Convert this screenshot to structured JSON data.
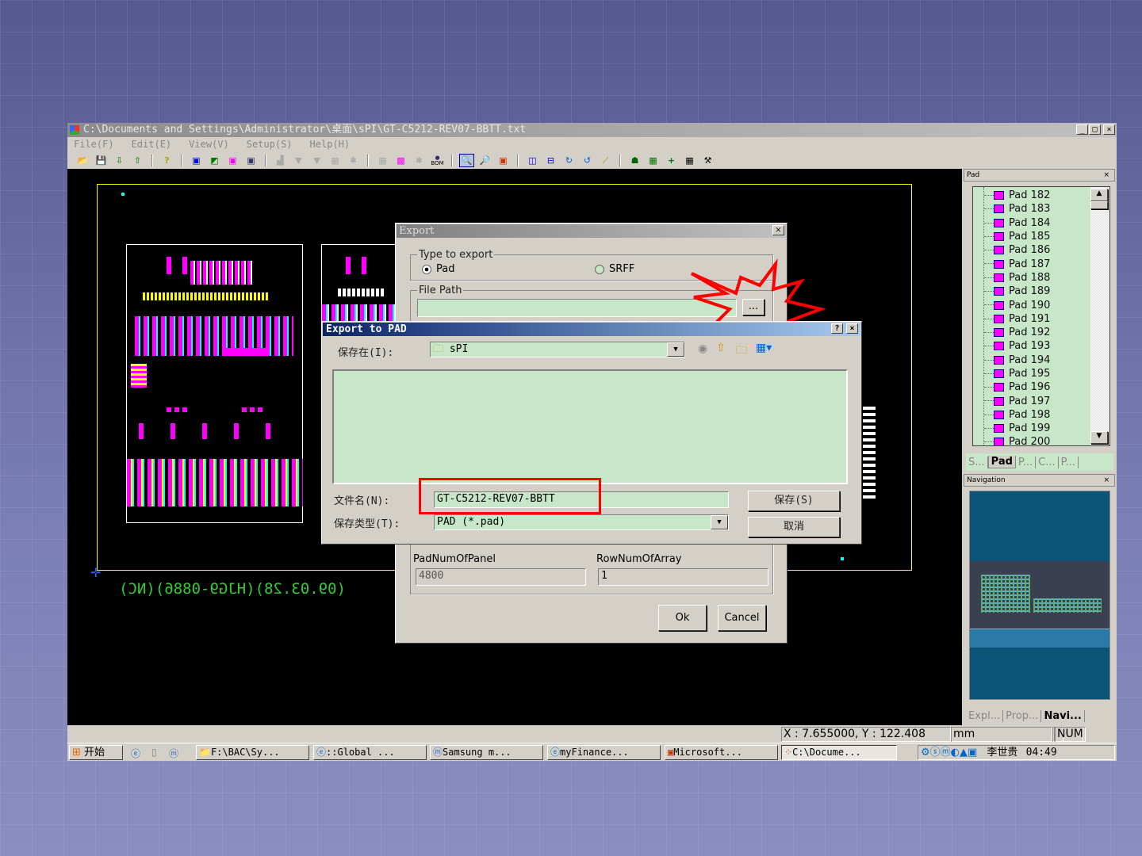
{
  "window": {
    "title": "C:\\Documents and Settings\\Administrator\\桌面\\sPI\\GT-C5212-REV07-BBTT.txt",
    "min": "_",
    "max": "□",
    "close": "×"
  },
  "menu": [
    "File(F)",
    "Edit(E)",
    "View(V)",
    "Setup(S)",
    "Help(H)"
  ],
  "toolbar": {
    "bom_label": "BOM"
  },
  "canvas": {
    "mirrored_text": "(09.03.28)(HJG9-0886)(NC)"
  },
  "export_dialog": {
    "title": "Export",
    "type_group": "Type to export",
    "opt_pad": "Pad",
    "opt_srff": "SRFF",
    "selected": "Pad",
    "path_group": "File Path",
    "path_value": "",
    "browse": "...",
    "pad_num_label": "PadNumOfPanel",
    "pad_num_value": "4800",
    "row_num_label": "RowNumOfArray",
    "row_num_value": "1",
    "ok": "Ok",
    "cancel": "Cancel"
  },
  "save_dialog": {
    "title": "Export to PAD",
    "help": "?",
    "close": "×",
    "save_in_label": "保存在(I):",
    "save_in_value": "sPI",
    "filename_label": "文件名(N):",
    "filename_value": "GT-C5212-REV07-BBTT",
    "filetype_label": "保存类型(T):",
    "filetype_value": "PAD (*.pad)",
    "save": "保存(S)",
    "cancel": "取消"
  },
  "highlight_color": "#ff0000",
  "pad_panel": {
    "title": "Pad",
    "close": "×",
    "items": [
      "Pad 182",
      "Pad 183",
      "Pad 184",
      "Pad 185",
      "Pad 186",
      "Pad 187",
      "Pad 188",
      "Pad 189",
      "Pad 190",
      "Pad 191",
      "Pad 192",
      "Pad 193",
      "Pad 194",
      "Pad 195",
      "Pad 196",
      "Pad 197",
      "Pad 198",
      "Pad 199",
      "Pad 200"
    ],
    "tabs": [
      "S...",
      "Pad",
      "P...",
      "C...",
      "P..."
    ]
  },
  "nav_panel": {
    "title": "Navigation",
    "close": "×",
    "tabs": [
      "Expl...",
      "Prop...",
      "Navi..."
    ]
  },
  "status": {
    "coords": "X : 7.655000, Y : 122.408",
    "unit": "mm",
    "num": "NUM"
  },
  "taskbar": {
    "start": "开始",
    "tasks": [
      "F:\\BAC\\Sy...",
      "::Global ...",
      "Samsung m...",
      "myFinance...",
      "Microsoft...",
      "C:\\Docume..."
    ],
    "user": "李世贵",
    "clock": "04:49"
  }
}
